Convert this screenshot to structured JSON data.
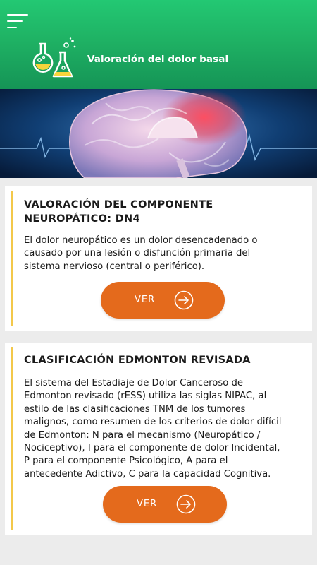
{
  "header": {
    "title": "Valoración del dolor basal",
    "menu_icon": "hamburger-menu-icon",
    "logo_icon": "lab-flasks-icon",
    "accent": "#1fb264"
  },
  "banner": {
    "image": "brain-mri-illustration"
  },
  "cards": [
    {
      "title_line1": "VALORACIÓN DEL COMPONENTE",
      "title_line2": "NEUROPÁTICO: DN4",
      "text": [
        "El dolor neuropático es un dolor desencadenado o",
        "causado por una lesión o disfunción primaria del",
        "sistema nervioso (central o periférico)."
      ],
      "button_label": "VER"
    },
    {
      "title_line1": "CLASIFICACIÓN EDMONTON REVISADA",
      "text": [
        "El sistema del Estadiaje de Dolor Canceroso de",
        "Edmonton revisado (rESS) utiliza las siglas NIPAC, al",
        "estilo de las clasificaciones TNM de los tumores",
        "malignos, como resumen de los criterios de dolor difícil",
        "de Edmonton: N para el mecanismo (Neuropático /",
        "Nociceptivo), I para el componente de dolor Incidental,",
        "P para el componente Psicológico, A para el",
        "antecedente Adictivo, C para la capacidad Cognitiva."
      ],
      "button_label": "VER"
    }
  ],
  "colors": {
    "button": "#e46a1c",
    "card_accent": "#f3c84a",
    "background": "#ececec"
  }
}
